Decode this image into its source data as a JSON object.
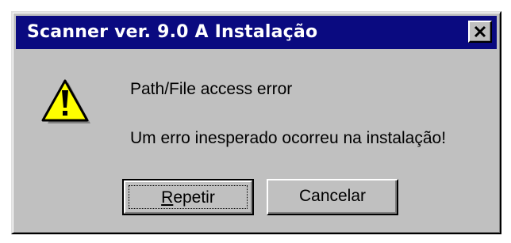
{
  "dialog": {
    "title": "Scanner ver. 9.0 A Instalação",
    "close_icon": "close-x-icon",
    "message_icon": "warning-icon",
    "message_heading": "Path/File access error",
    "message_body": "Um erro inesperado ocorreu na instalação!",
    "buttons": {
      "retry": {
        "mnemonic": "R",
        "rest": "epetir"
      },
      "cancel": "Cancelar"
    }
  },
  "colors": {
    "titlebar": "#0a0a80",
    "face": "#c0c0c0",
    "warning_yellow": "#ffff00"
  }
}
